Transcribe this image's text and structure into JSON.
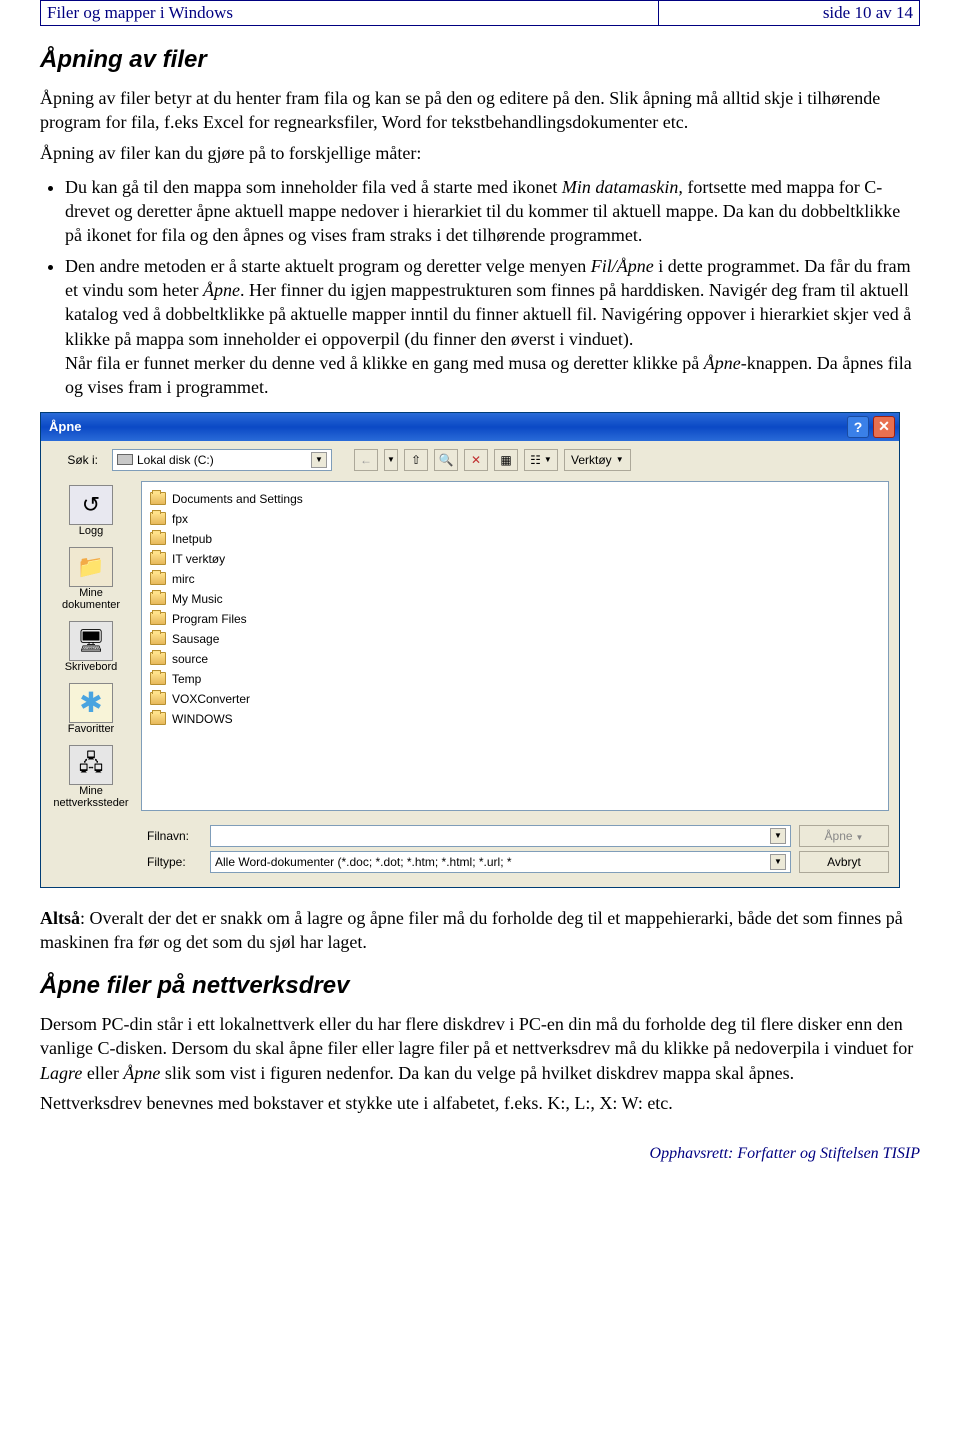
{
  "header": {
    "left": "Filer og mapper i Windows",
    "right": "side 10 av 14"
  },
  "section1_title": "Åpning av filer",
  "para1": "Åpning av filer betyr at du henter fram fila og kan se på den og editere på den. Slik åpning må alltid skje i tilhørende program for fila, f.eks Excel for regnearksfiler, Word for tekstbehandlingsdokumenter etc.",
  "para2": "Åpning av filer kan du gjøre på to forskjellige måter:",
  "bullet1_a": "Du kan gå til den mappa som inneholder fila ved å starte med ikonet ",
  "bullet1_b_it": "Min datamaskin,",
  "bullet1_c": " fortsette med mappa for C-drevet og deretter åpne aktuell mappe nedover i hierarkiet til du kommer til aktuell mappe. Da kan du dobbeltklikke på ikonet for fila og den åpnes og vises fram straks i det tilhørende programmet.",
  "bullet2_a": "Den andre metoden er å starte aktuelt program og deretter velge menyen ",
  "bullet2_b_it": "Fil/Åpne",
  "bullet2_c": " i dette programmet. Da får du fram et vindu som heter ",
  "bullet2_d_it": "Åpne",
  "bullet2_e": ". Her finner du igjen mappestrukturen som finnes på harddisken. Navigér deg fram til aktuell katalog ved å dobbeltklikke på aktuelle mapper inntil du finner aktuell fil. Navigéring oppover i hierarkiet skjer ved å klikke på mappa som inneholder ei oppoverpil (du finner den øverst i vinduet).",
  "bullet2_f": "Når fila er funnet merker du denne ved å klikke en gang med musa og deretter klikke på ",
  "bullet2_g_it": "Åpne",
  "bullet2_h": "-knappen. Da åpnes fila og vises fram i programmet.",
  "dialog": {
    "title": "Åpne",
    "searchin_label": "Søk i:",
    "searchin_value": "Lokal disk (C:)",
    "tools_label": "Verktøy",
    "sidebar": {
      "logg": "Logg",
      "docs": "Mine\ndokumenter",
      "desk": "Skrivebord",
      "fav": "Favoritter",
      "net": "Mine\nnettverkssteder"
    },
    "folders": [
      "Documents and Settings",
      "fpx",
      "Inetpub",
      "IT verktøy",
      "mirc",
      "My Music",
      "Program Files",
      "Sausage",
      "source",
      "Temp",
      "VOXConverter",
      "WINDOWS"
    ],
    "filename_label": "Filnavn:",
    "filename_value": "",
    "filetype_label": "Filtype:",
    "filetype_value": "Alle Word-dokumenter (*.doc; *.dot; *.htm; *.html; *.url; *",
    "open_button": "Åpne",
    "cancel_button": "Avbryt"
  },
  "para3_a": "Altså",
  "para3_b": ": Overalt der det er snakk om å lagre og åpne filer må du forholde deg til et mappehierarki, både det som finnes på maskinen fra før og det som du sjøl har laget.",
  "section2_title": "Åpne filer på nettverksdrev",
  "para4_a": "Dersom PC-din står i ett lokalnettverk eller du har flere diskdrev i PC-en din må du forholde deg til flere disker enn den vanlige C-disken. Dersom du skal åpne filer eller lagre filer på et nettverksdrev må du klikke på nedoverpila i vinduet for ",
  "para4_b_it": "Lagre",
  "para4_c": " eller ",
  "para4_d_it": "Åpne",
  "para4_e": " slik som vist i figuren nedenfor. Da kan du velge på hvilket diskdrev mappa skal åpnes.",
  "para5": "Nettverksdrev benevnes med bokstaver et stykke ute i alfabetet, f.eks. K:, L:, X: W: etc.",
  "footer": "Opphavsrett:  Forfatter og Stiftelsen TISIP"
}
